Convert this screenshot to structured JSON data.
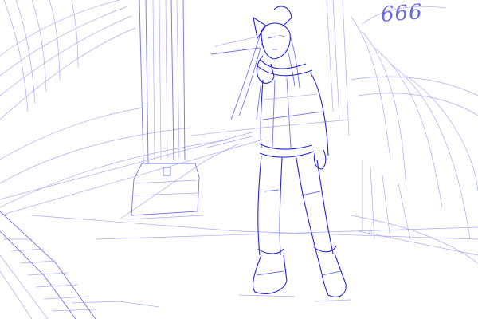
{
  "artwork": {
    "signature": "666",
    "ink_color": "#2424d6",
    "faint_ink_color": "#8f8ff2",
    "background_color": "#ffffff"
  }
}
